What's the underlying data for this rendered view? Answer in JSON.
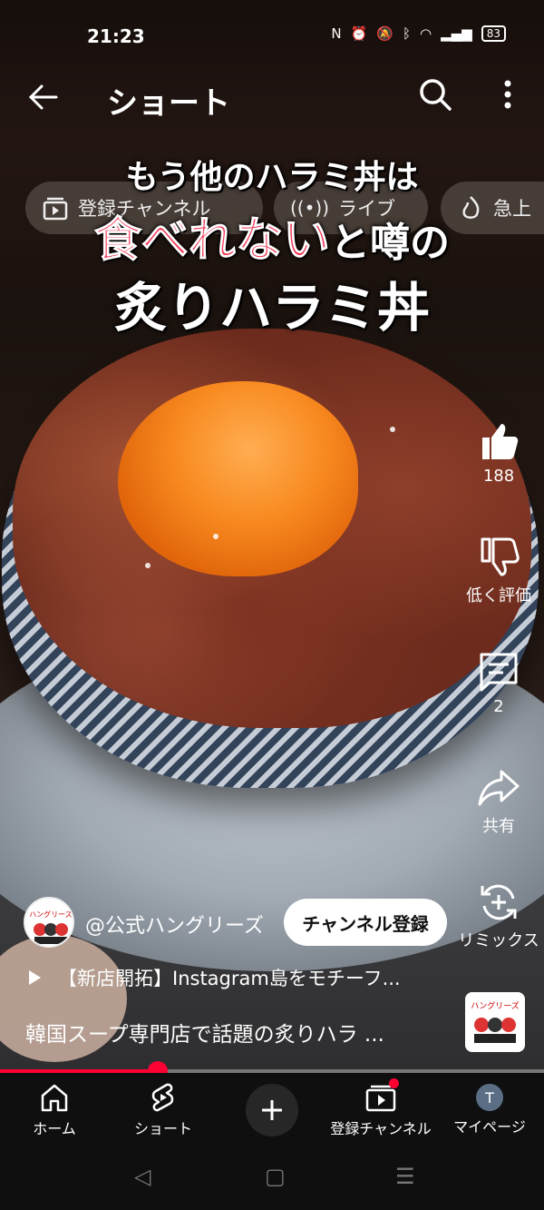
{
  "status": {
    "time": "21:23",
    "battery": "83"
  },
  "header": {
    "title": "ショート"
  },
  "chips": [
    {
      "label": "登録チャンネル",
      "icon": "subscriptions-icon"
    },
    {
      "label": "ライブ",
      "icon": "live-icon"
    },
    {
      "label": "急上",
      "icon": "trending-icon"
    }
  ],
  "caption": {
    "line1": "もう他のハラミ丼は",
    "line2_hot": "食べれない",
    "line2_rest": "と噂の",
    "line3": "炙りハラミ丼"
  },
  "rail": {
    "likes": "188",
    "dislike_label": "低く評価",
    "comments": "2",
    "share_label": "共有",
    "remix_label": "リミックス"
  },
  "channel": {
    "name": "@公式ハングリーズ",
    "subscribe_label": "チャンネル登録",
    "avatar_text": "ハングリーズ"
  },
  "playlist": {
    "title": "【新店開拓】Instagram島をモチーフ..."
  },
  "description": "韓国スープ専門店で話題の炙りハラ ...",
  "progress": {
    "percent": 29
  },
  "nav": {
    "home": "ホーム",
    "shorts": "ショート",
    "subs": "登録チャンネル",
    "me": "マイページ",
    "me_initial": "T"
  },
  "colors": {
    "accent": "#ff0033",
    "headline": "#f23a58"
  }
}
